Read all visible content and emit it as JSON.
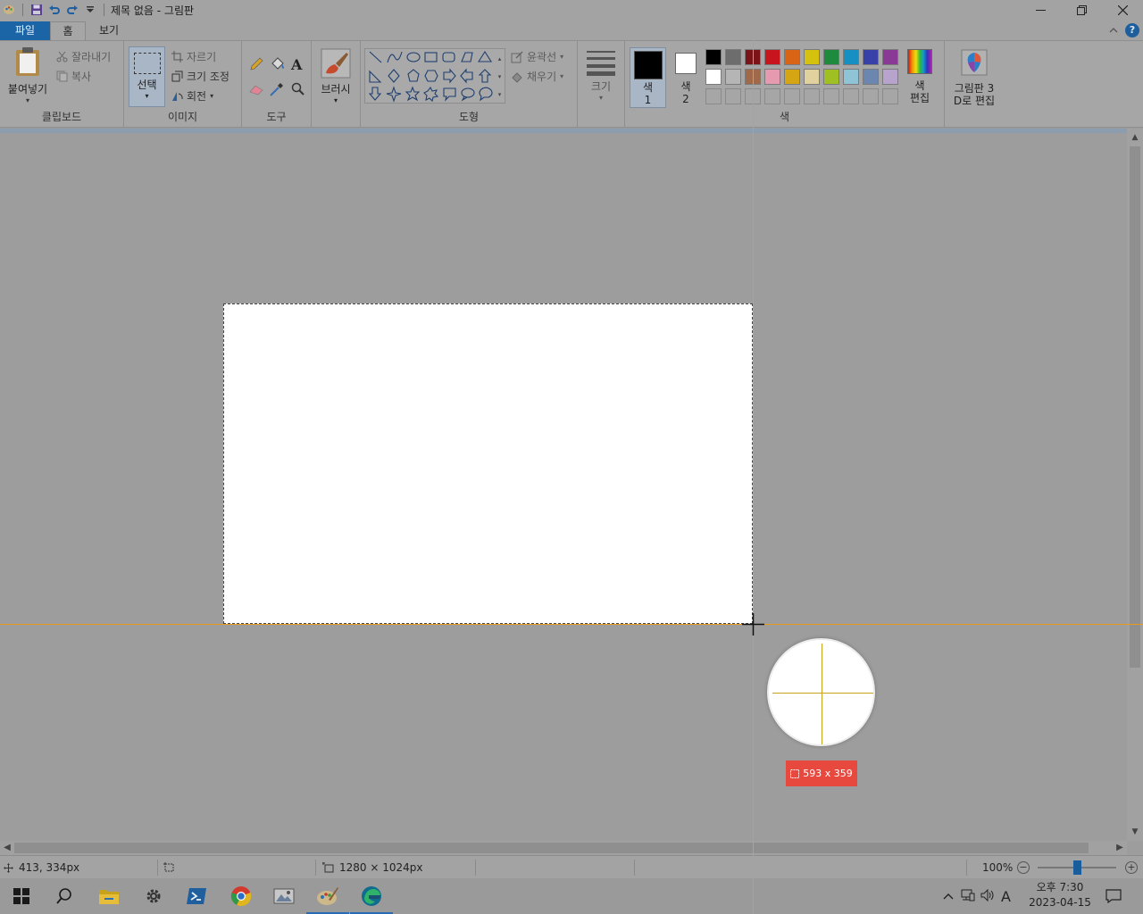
{
  "window": {
    "title": "제목 없음 - 그림판",
    "qa_icons": [
      "paint-app-icon",
      "save-icon",
      "undo-icon",
      "redo-icon",
      "customize-dropdown-icon"
    ],
    "controls": [
      "minimize-icon",
      "restore-icon",
      "close-icon"
    ]
  },
  "tabs": {
    "file": "파일",
    "home": "홈",
    "view": "보기"
  },
  "clipboard": {
    "paste": "붙여넣기",
    "cut": "잘라내기",
    "copy": "복사",
    "label": "클립보드"
  },
  "image": {
    "select": "선택",
    "crop": "자르기",
    "resize": "크기 조정",
    "rotate": "회전",
    "label": "이미지"
  },
  "tools": {
    "label": "도구"
  },
  "brushes": {
    "label": "브러시"
  },
  "shapes": {
    "outline": "윤곽선",
    "fill": "채우기",
    "label": "도형"
  },
  "size": {
    "label": "크기"
  },
  "colors": {
    "color1_l1": "색",
    "color1_l2": "1",
    "color2_l1": "색",
    "color2_l2": "2",
    "edit_l1": "색",
    "edit_l2": "편집",
    "label": "색",
    "color1_value": "#000000",
    "color2_value": "#ffffff",
    "palette_row1": [
      "#000000",
      "#6d6d6d",
      "#7a1418",
      "#c8151d",
      "#d96415",
      "#d4c20f",
      "#1e8a3e",
      "#168fc2",
      "#3940a8",
      "#8a3a96"
    ],
    "palette_row2": [
      "#ffffff",
      "#b5b5b5",
      "#a06a4a",
      "#e59ab0",
      "#d6a514",
      "#e0d19e",
      "#9fbf22",
      "#8fc4d6",
      "#6b87b0",
      "#b7a3cb"
    ]
  },
  "paint3d": {
    "l1": "그림판 3",
    "l2": "D로 편집"
  },
  "selection_tag": {
    "size": "593 x 359"
  },
  "status": {
    "cursor_pos": "413, 334px",
    "selection_size": "",
    "canvas_size": "1280 × 1024px",
    "zoom": "100%"
  },
  "taskbar": {
    "apps": [
      "start-icon",
      "search-icon",
      "file-explorer-icon",
      "settings-icon",
      "powershell-icon",
      "chrome-icon",
      "photos-icon",
      "paint-icon",
      "edge-icon"
    ],
    "time": "오후 7:30",
    "date": "2023-04-15",
    "ime": "A"
  }
}
